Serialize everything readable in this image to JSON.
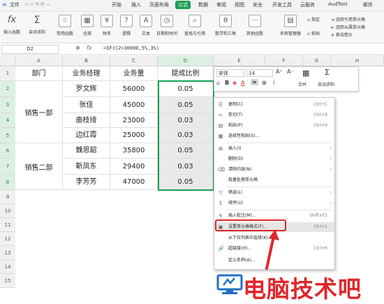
{
  "menubar": {
    "file": "文件",
    "items": [
      "开始",
      "插入",
      "页面布局",
      "公式",
      "数据",
      "审阅",
      "视图",
      "安全",
      "开发工具",
      "云服务",
      "AudTool",
      "邮件"
    ],
    "active": "公式"
  },
  "ribbon": {
    "insert_function": "插入函数",
    "autosum": "自动求和",
    "common": "常用函数",
    "all": "全部",
    "finance": "财务",
    "logic": "逻辑",
    "text": "文本",
    "datetime": "日期和时间",
    "lookup": "查找与引用",
    "math": "数学和三角",
    "other": "其他函数",
    "name_manager": "名称管理器",
    "paste": "粘贴",
    "specify": "指定",
    "trace_precedents": "追踪引用单元格",
    "trace_dependents": "追踪从属单元格",
    "remove_arrows": "移去箭头"
  },
  "formula_bar": {
    "cell_ref": "D2",
    "zoom_icon": "⊕",
    "fx": "fx",
    "formula": "=IF(C2>30000,5%,3%)"
  },
  "columns": [
    "A",
    "B",
    "C",
    "D",
    "E",
    "F",
    "G",
    "H"
  ],
  "rows": [
    "1",
    "2",
    "3",
    "4",
    "5",
    "6",
    "7",
    "8",
    "9",
    "10",
    "11",
    "12",
    "13",
    "14",
    "15"
  ],
  "table": {
    "headers": [
      "部门",
      "业务经理",
      "业务量",
      "提成比例"
    ],
    "dept1": "销售一部",
    "dept2": "销售二部",
    "records": [
      {
        "manager": "罗文辉",
        "volume": "56000",
        "rate": "0.05"
      },
      {
        "manager": "张佳",
        "volume": "45000",
        "rate": "0.05"
      },
      {
        "manager": "曲枝绮",
        "volume": "23000",
        "rate": "0.03"
      },
      {
        "manager": "边红霞",
        "volume": "25000",
        "rate": "0.03"
      },
      {
        "manager": "魏思韶",
        "volume": "35800",
        "rate": "0.05"
      },
      {
        "manager": "靳凤东",
        "volume": "29400",
        "rate": "0.03"
      },
      {
        "manager": "李芳芳",
        "volume": "47000",
        "rate": "0.05"
      }
    ]
  },
  "mini_toolbar": {
    "font": "宋体",
    "size": "14",
    "merge": "合并",
    "autosum": "自动求和"
  },
  "context_menu": [
    {
      "icon": "⎘",
      "label": "复制(C)",
      "shortcut": "Ctrl+C"
    },
    {
      "icon": "✂",
      "label": "剪切(T)",
      "shortcut": "Ctrl+X"
    },
    {
      "icon": "▤",
      "label": "粘贴(P)",
      "shortcut": "Ctrl+V"
    },
    {
      "icon": "▦",
      "label": "选择性粘贴(S)...",
      "shortcut": ""
    },
    {
      "icon": "⊞",
      "label": "插入(I)",
      "shortcut": ""
    },
    {
      "icon": "",
      "label": "删除(D)",
      "shortcut": ""
    },
    {
      "icon": "⌫",
      "label": "清除内容(N)",
      "shortcut": ""
    },
    {
      "icon": "",
      "label": "批量处理单元格",
      "shortcut": ""
    },
    {
      "icon": "▽",
      "label": "筛选(L)",
      "shortcut": ""
    },
    {
      "icon": "↕",
      "label": "排序(U)",
      "shortcut": ""
    },
    {
      "icon": "✎",
      "label": "插入批注(M)...",
      "shortcut": "Shift+F2"
    },
    {
      "icon": "▣",
      "label": "设置单元格格式(F)...",
      "shortcut": "Ctrl+1"
    },
    {
      "icon": "",
      "label": "从下拉列表中选择(K)...",
      "shortcut": ""
    },
    {
      "icon": "🔗",
      "label": "超链接(H)...",
      "shortcut": "Ctrl+K"
    },
    {
      "icon": "",
      "label": "定义名称(A)...",
      "shortcut": ""
    }
  ],
  "watermark": {
    "text": "电脑技术吧"
  },
  "colors": {
    "accent": "#1a9f54",
    "highlight": "#e0262a",
    "watermark_blue": "#1f6fc4"
  }
}
